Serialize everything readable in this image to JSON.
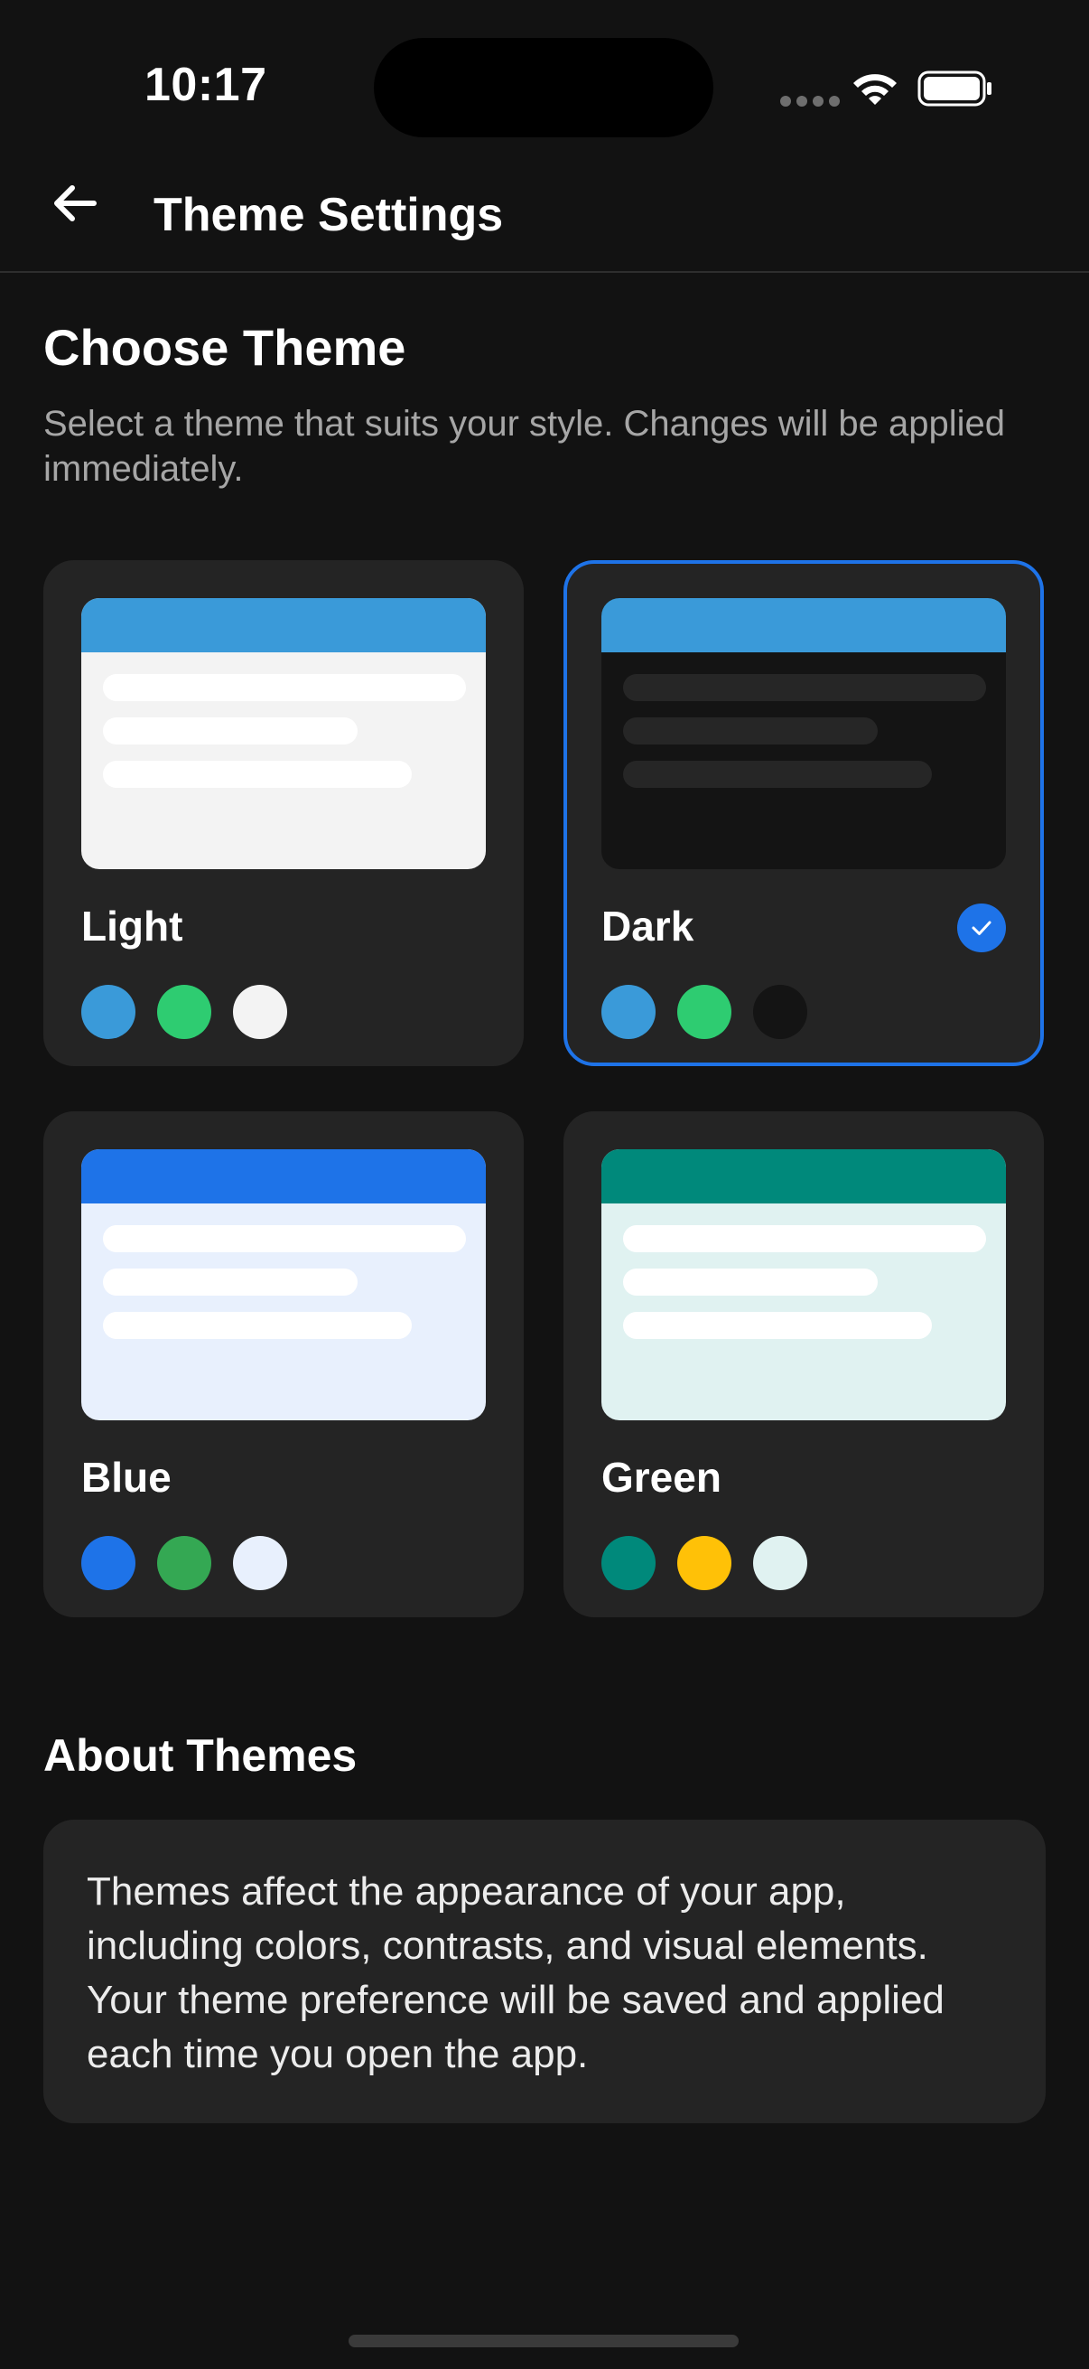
{
  "status_bar": {
    "time": "10:17"
  },
  "app_bar": {
    "title": "Theme Settings",
    "back_icon": "arrow-left-icon"
  },
  "choose": {
    "title": "Choose Theme",
    "description": "Select a theme that suits your style. Changes will be applied immediately."
  },
  "themes": [
    {
      "name": "Light",
      "selected": false,
      "header_color": "#3a9ad9",
      "body_color": "#f3f3f3",
      "line_color": "#ffffff",
      "swatches": [
        "#3a9ad9",
        "#2ecc71",
        "#f3f3f3"
      ]
    },
    {
      "name": "Dark",
      "selected": true,
      "header_color": "#3a9ad9",
      "body_color": "#141414",
      "line_color": "#262626",
      "swatches": [
        "#3a9ad9",
        "#2ecc71",
        "#141414"
      ]
    },
    {
      "name": "Blue",
      "selected": false,
      "header_color": "#1e73e8",
      "body_color": "#e8f0fd",
      "line_color": "#ffffff",
      "swatches": [
        "#1e73e8",
        "#34a853",
        "#e8f0fd"
      ]
    },
    {
      "name": "Green",
      "selected": false,
      "header_color": "#00897b",
      "body_color": "#e0f2f1",
      "line_color": "#ffffff",
      "swatches": [
        "#00897b",
        "#ffc107",
        "#e0f2f1"
      ]
    }
  ],
  "about": {
    "title": "About Themes",
    "text": "Themes affect the appearance of your app, including colors, contrasts, and visual elements. Your theme preference will be saved and applied each time you open the app."
  },
  "colors": {
    "background": "#121212",
    "card": "#242424",
    "accent": "#1e73e8"
  }
}
